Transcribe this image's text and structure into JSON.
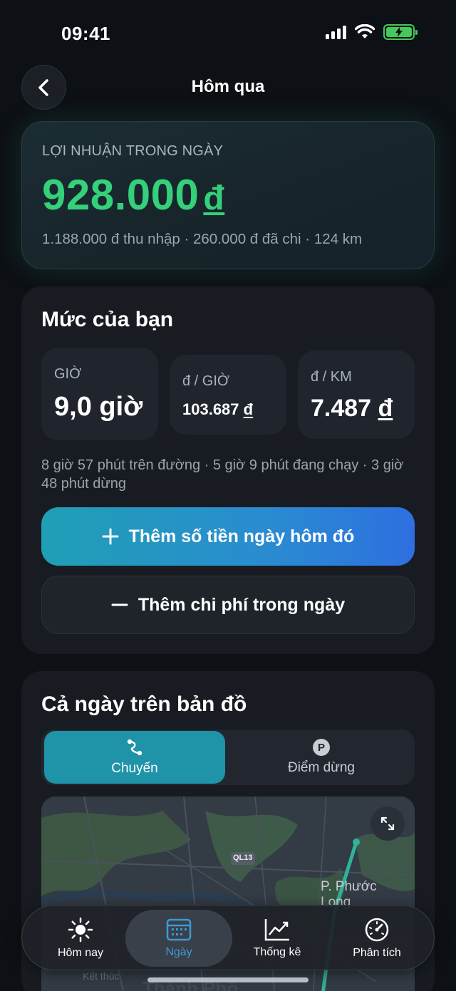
{
  "status_bar": {
    "time": "09:41"
  },
  "header": {
    "title": "Hôm qua"
  },
  "profit": {
    "label": "LỢI NHUẬN TRONG NGÀY",
    "amount": "928.000",
    "currency": "đ",
    "summary": "1.188.000 đ thu nhập · 260.000 đ đã chi · 124 km"
  },
  "rates": {
    "title": "Mức của bạn",
    "stats": [
      {
        "label": "GIỜ",
        "value": "9,0 giờ",
        "unit": ""
      },
      {
        "label": "đ / GIỜ",
        "value": "103.687",
        "unit": "đ"
      },
      {
        "label": "đ / KM",
        "value": "7.487",
        "unit": "đ"
      }
    ],
    "note": "8 giờ 57 phút trên đường · 5 giờ 9 phút đang chạy · 3 giờ 48 phút dừng",
    "add_income_button": "Thêm số tiền ngày hôm đó",
    "add_expense_button": "Thêm chi phí trong ngày"
  },
  "map_section": {
    "title": "Cả ngày trên bản đồ",
    "segments": [
      {
        "label": "Chuyến",
        "icon": "route-icon",
        "active": true
      },
      {
        "label": "Điểm dừng",
        "icon": "parking-icon",
        "active": false
      }
    ],
    "map_labels": {
      "road": "QL13",
      "district": "P. Phước Long",
      "end": "Kết thúc",
      "city": "Thành Phố"
    }
  },
  "tab_bar": {
    "tabs": [
      {
        "label": "Hôm nay",
        "icon": "sun-icon"
      },
      {
        "label": "Ngày",
        "icon": "calendar-icon",
        "active": true
      },
      {
        "label": "Thống kê",
        "icon": "chart-icon"
      },
      {
        "label": "Phân tích",
        "icon": "gauge-icon"
      }
    ]
  },
  "colors": {
    "profit_green": "#35d07a",
    "accent_teal": "#1f93a8",
    "accent_blue": "#2e6fe0",
    "route_line": "#2fb39a"
  }
}
